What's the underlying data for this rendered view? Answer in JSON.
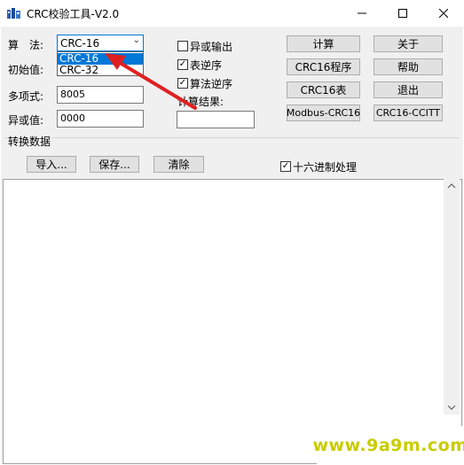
{
  "window": {
    "title": "CRC校验工具-V2.0",
    "icons": {
      "app": "app-icon",
      "minimize": "minimize-icon",
      "maximize": "maximize-icon",
      "close": "close-icon"
    }
  },
  "form": {
    "algorithm_label": "算　法:",
    "algorithm_value": "CRC-16",
    "algorithm_options": [
      "CRC-16",
      "CRC-32"
    ],
    "initial_label": "初始值:",
    "poly_label": "多项式:",
    "poly_value": "8005",
    "xor_label": "异或值:",
    "xor_value": "0000"
  },
  "options": {
    "xor_output": {
      "label": "异或输出",
      "checked": false
    },
    "table_reverse": {
      "label": "表逆序",
      "checked": true
    },
    "algo_reverse": {
      "label": "算法逆序",
      "checked": true
    },
    "result_label": "计算结果:",
    "result_value": ""
  },
  "buttons": {
    "calc": "计算",
    "about": "关于",
    "crc16_prog": "CRC16程序",
    "help": "帮助",
    "crc16_table": "CRC16表",
    "exit": "退出",
    "modbus": "Modbus-CRC16",
    "ccitt": "CRC16-CCITT"
  },
  "convert": {
    "section_label": "转换数据",
    "import": "导入...",
    "save": "保存...",
    "clear": "清除",
    "hex_label": "十六进制处理",
    "hex_checked": true,
    "data_text": ""
  },
  "watermark": "www.9a9m.com",
  "colors": {
    "accent": "#0078d7",
    "arrow": "#e02020",
    "watermark": "#c9cc00"
  }
}
